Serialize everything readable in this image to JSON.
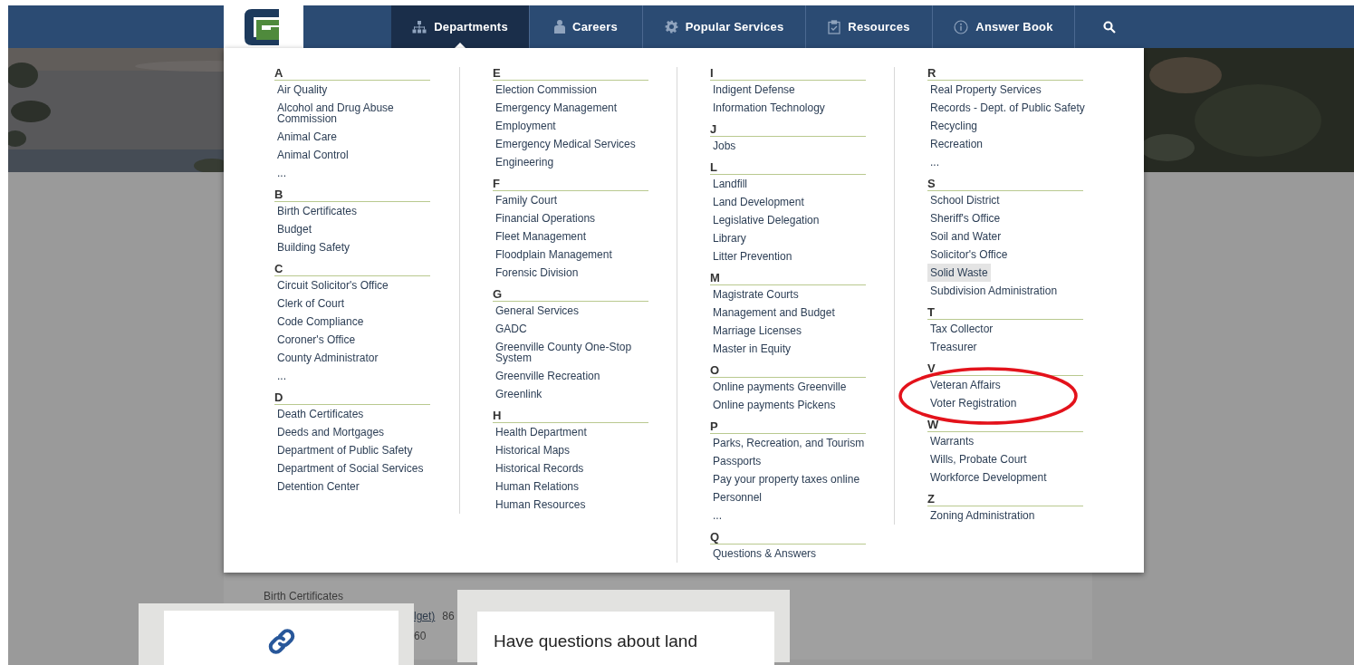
{
  "nav": {
    "items": [
      {
        "label": "Departments",
        "selected": true
      },
      {
        "label": "Careers",
        "selected": false
      },
      {
        "label": "Popular Services",
        "selected": false
      },
      {
        "label": "Resources",
        "selected": false
      },
      {
        "label": "Answer Book",
        "selected": false
      }
    ]
  },
  "menu": {
    "columns": [
      {
        "sections": [
          {
            "letter": "A",
            "items": [
              {
                "label": "Air Quality",
                "highlighted": false
              },
              {
                "label": "Alcohol and Drug Abuse Commission",
                "highlighted": false
              },
              {
                "label": "Animal Care",
                "highlighted": false
              },
              {
                "label": "Animal Control",
                "highlighted": false
              },
              {
                "label": "...",
                "highlighted": false
              }
            ]
          },
          {
            "letter": "B",
            "items": [
              {
                "label": "Birth Certificates",
                "highlighted": false
              },
              {
                "label": "Budget",
                "highlighted": false
              },
              {
                "label": "Building Safety",
                "highlighted": false
              }
            ]
          },
          {
            "letter": "C",
            "items": [
              {
                "label": "Circuit Solicitor's Office",
                "highlighted": false
              },
              {
                "label": "Clerk of Court",
                "highlighted": false
              },
              {
                "label": "Code Compliance",
                "highlighted": false
              },
              {
                "label": "Coroner's Office",
                "highlighted": false
              },
              {
                "label": "County Administrator",
                "highlighted": false
              },
              {
                "label": "...",
                "highlighted": false
              }
            ]
          },
          {
            "letter": "D",
            "items": [
              {
                "label": "Death Certificates",
                "highlighted": false
              },
              {
                "label": "Deeds and Mortgages",
                "highlighted": false
              },
              {
                "label": "Department of Public Safety",
                "highlighted": false
              },
              {
                "label": "Department of Social Services",
                "highlighted": false
              },
              {
                "label": "Detention Center",
                "highlighted": false
              }
            ]
          }
        ]
      },
      {
        "sections": [
          {
            "letter": "E",
            "items": [
              {
                "label": "Election Commission",
                "highlighted": false
              },
              {
                "label": "Emergency Management",
                "highlighted": false
              },
              {
                "label": "Employment",
                "highlighted": false
              },
              {
                "label": "Emergency Medical Services",
                "highlighted": false
              },
              {
                "label": "Engineering",
                "highlighted": false
              }
            ]
          },
          {
            "letter": "F",
            "items": [
              {
                "label": "Family Court",
                "highlighted": false
              },
              {
                "label": "Financial Operations",
                "highlighted": false
              },
              {
                "label": "Fleet Management",
                "highlighted": false
              },
              {
                "label": "Floodplain Management",
                "highlighted": false
              },
              {
                "label": "Forensic Division",
                "highlighted": false
              }
            ]
          },
          {
            "letter": "G",
            "items": [
              {
                "label": "General Services",
                "highlighted": false
              },
              {
                "label": "GADC",
                "highlighted": false
              },
              {
                "label": "Greenville County One-Stop System",
                "highlighted": false
              },
              {
                "label": "Greenville Recreation",
                "highlighted": false
              },
              {
                "label": "Greenlink",
                "highlighted": false
              }
            ]
          },
          {
            "letter": "H",
            "items": [
              {
                "label": "Health Department",
                "highlighted": false
              },
              {
                "label": "Historical Maps",
                "highlighted": false
              },
              {
                "label": "Historical Records",
                "highlighted": false
              },
              {
                "label": "Human Relations",
                "highlighted": false
              },
              {
                "label": "Human Resources",
                "highlighted": false
              }
            ]
          }
        ]
      },
      {
        "sections": [
          {
            "letter": "I",
            "items": [
              {
                "label": "Indigent Defense",
                "highlighted": false
              },
              {
                "label": "Information Technology",
                "highlighted": false
              }
            ]
          },
          {
            "letter": "J",
            "items": [
              {
                "label": "Jobs",
                "highlighted": false
              }
            ]
          },
          {
            "letter": "L",
            "items": [
              {
                "label": "Landfill",
                "highlighted": false
              },
              {
                "label": "Land Development",
                "highlighted": false
              },
              {
                "label": "Legislative Delegation",
                "highlighted": false
              },
              {
                "label": "Library",
                "highlighted": false
              },
              {
                "label": "Litter Prevention",
                "highlighted": false
              }
            ]
          },
          {
            "letter": "M",
            "items": [
              {
                "label": "Magistrate Courts",
                "highlighted": false
              },
              {
                "label": "Management and Budget",
                "highlighted": false
              },
              {
                "label": "Marriage Licenses",
                "highlighted": false
              },
              {
                "label": "Master in Equity",
                "highlighted": false
              }
            ]
          },
          {
            "letter": "O",
            "items": [
              {
                "label": "Online payments Greenville",
                "highlighted": false
              },
              {
                "label": "Online payments Pickens",
                "highlighted": false
              }
            ]
          },
          {
            "letter": "P",
            "items": [
              {
                "label": "Parks, Recreation, and Tourism",
                "highlighted": false
              },
              {
                "label": "Passports",
                "highlighted": false
              },
              {
                "label": "Pay your property taxes online",
                "highlighted": false
              },
              {
                "label": "Personnel",
                "highlighted": false
              },
              {
                "label": "...",
                "highlighted": false
              }
            ]
          },
          {
            "letter": "Q",
            "items": [
              {
                "label": "Questions & Answers",
                "highlighted": false
              }
            ]
          }
        ]
      },
      {
        "sections": [
          {
            "letter": "R",
            "items": [
              {
                "label": "Real Property Services",
                "highlighted": false
              },
              {
                "label": "Records - Dept. of Public Safety",
                "highlighted": false
              },
              {
                "label": "Recycling",
                "highlighted": false
              },
              {
                "label": "Recreation",
                "highlighted": false
              },
              {
                "label": "...",
                "highlighted": false
              }
            ]
          },
          {
            "letter": "S",
            "items": [
              {
                "label": "School District",
                "highlighted": false
              },
              {
                "label": "Sheriff's Office",
                "highlighted": false
              },
              {
                "label": "Soil and Water",
                "highlighted": false
              },
              {
                "label": "Solicitor's Office",
                "highlighted": false
              },
              {
                "label": "Solid Waste",
                "highlighted": true
              },
              {
                "label": "Subdivision Administration",
                "highlighted": false
              }
            ]
          },
          {
            "letter": "T",
            "items": [
              {
                "label": "Tax Collector",
                "highlighted": false
              },
              {
                "label": "Treasurer",
                "highlighted": false
              }
            ]
          },
          {
            "letter": "V",
            "items": [
              {
                "label": "Veteran Affairs",
                "highlighted": false
              },
              {
                "label": "Voter Registration",
                "highlighted": false
              }
            ]
          },
          {
            "letter": "W",
            "items": [
              {
                "label": "Warrants",
                "highlighted": false
              },
              {
                "label": "Wills, Probate Court",
                "highlighted": false
              },
              {
                "label": "Workforce Development",
                "highlighted": false
              }
            ]
          },
          {
            "letter": "Z",
            "items": [
              {
                "label": "Zoning Administration",
                "highlighted": false
              }
            ]
          }
        ]
      }
    ]
  },
  "annotation": {
    "kind": "ellipse"
  },
  "page_fragments": [
    {
      "kind": "text",
      "text": "Birth Certificates"
    },
    {
      "kind": "link",
      "text": "lget)"
    },
    {
      "kind": "text",
      "text": "86"
    },
    {
      "kind": "text",
      "text": "60"
    }
  ],
  "cards": [
    {
      "kind": "icon"
    },
    {
      "kind": "text",
      "text": "Have questions about land"
    }
  ]
}
